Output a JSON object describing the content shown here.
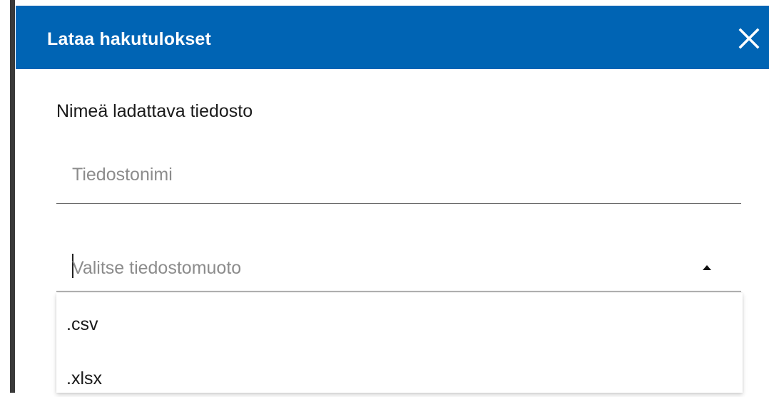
{
  "dialog": {
    "title": "Lataa hakutulokset",
    "close_icon": "close-icon",
    "header_color": "#0064b4"
  },
  "form": {
    "section_label": "Nimeä ladattava tiedosto",
    "filename": {
      "value": "",
      "placeholder": "Tiedostonimi"
    },
    "format_select": {
      "placeholder": "Valitse tiedostomuoto",
      "expanded": true,
      "toggle_icon": "chevron-up-icon",
      "options": [
        {
          "label": ".csv"
        },
        {
          "label": ".xlsx"
        }
      ]
    }
  }
}
